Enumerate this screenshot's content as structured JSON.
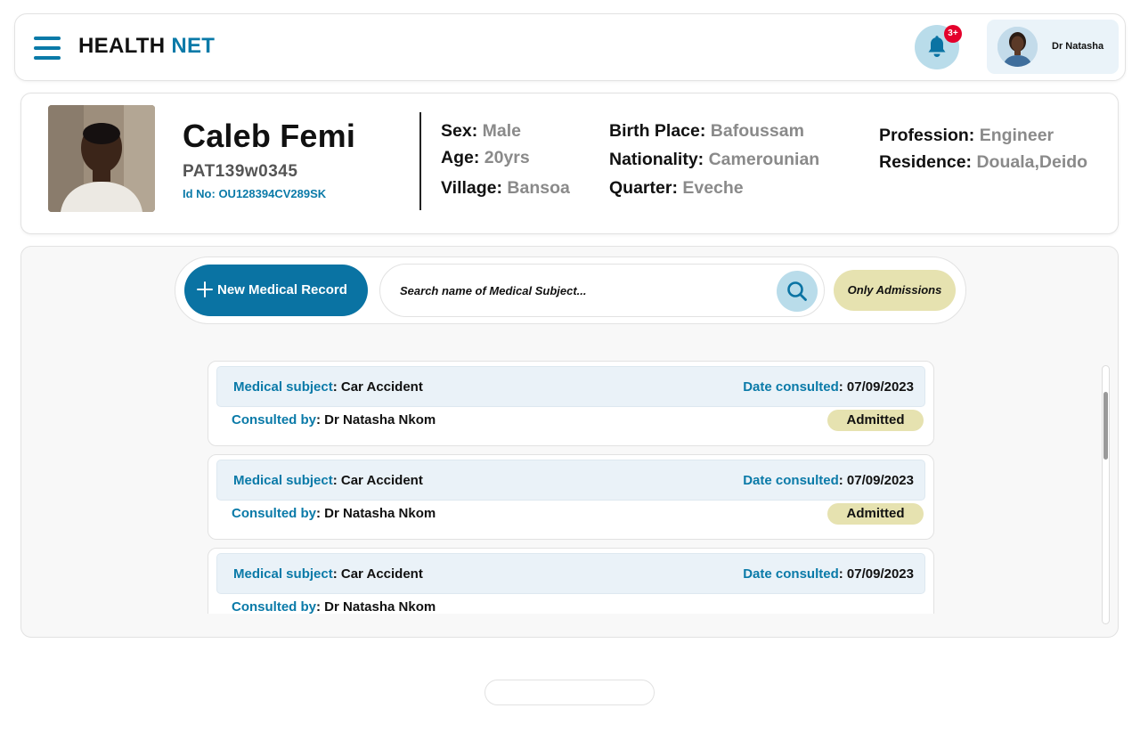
{
  "header": {
    "brand_part1": "HEALTH",
    "brand_part2": "NET",
    "notification_count": "3+",
    "user_name": "Dr Natasha"
  },
  "patient": {
    "name": "Caleb Femi",
    "code": "PAT139w0345",
    "id_label": "Id No: ",
    "id_value": "OU128394CV289SK",
    "fields": {
      "sex": {
        "label": "Sex: ",
        "value": "Male"
      },
      "age": {
        "label": "Age: ",
        "value": "20yrs"
      },
      "village": {
        "label": "Village: ",
        "value": "Bansoa"
      },
      "birth_place": {
        "label": "Birth Place: ",
        "value": "Bafoussam"
      },
      "nationality": {
        "label": "Nationality: ",
        "value": "Camerounian"
      },
      "quarter": {
        "label": "Quarter: ",
        "value": "Eveche"
      },
      "profession": {
        "label": "Profession: ",
        "value": "Engineer"
      },
      "residence": {
        "label": "Residence: ",
        "value": "Douala,Deido"
      }
    }
  },
  "toolbar": {
    "new_record_label": "New Medical Record",
    "search_placeholder": "Search name of Medical Subject...",
    "filter_label": "Only Admissions"
  },
  "records": [
    {
      "subject_label": "Medical subject",
      "subject": ": Car Accident",
      "date_label": "Date consulted",
      "date": ": 07/09/2023",
      "consulted_label": "Consulted by",
      "consulted": ": Dr Natasha Nkom",
      "status": "Admitted"
    },
    {
      "subject_label": "Medical subject",
      "subject": ": Car Accident",
      "date_label": "Date consulted",
      "date": ": 07/09/2023",
      "consulted_label": "Consulted by",
      "consulted": ": Dr Natasha Nkom",
      "status": "Admitted"
    },
    {
      "subject_label": "Medical subject",
      "subject": ": Car Accident",
      "date_label": "Date consulted",
      "date": ": 07/09/2023",
      "consulted_label": "Consulted by",
      "consulted": ": Dr Natasha Nkom",
      "status": ""
    }
  ],
  "colors": {
    "brand_blue": "#0a7aa8",
    "primary_button": "#0a73a3",
    "badge_yellow": "#e6e2b0",
    "notification_red": "#e4002b"
  },
  "icons": {
    "menu": "hamburger-icon",
    "notifications": "bell-icon",
    "add": "plus-icon",
    "search": "search-icon"
  }
}
